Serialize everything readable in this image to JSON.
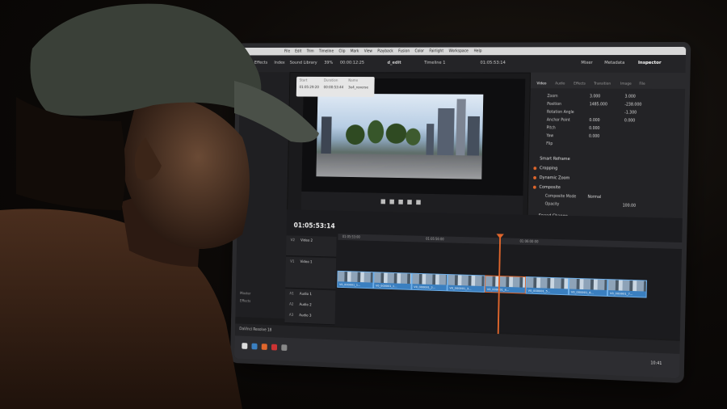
{
  "menu": [
    "File",
    "Edit",
    "Trim",
    "Timeline",
    "Clip",
    "Mark",
    "View",
    "Playback",
    "Fusion",
    "Color",
    "Fairlight",
    "Workspace",
    "Help"
  ],
  "toolbar": {
    "effects": "Effects",
    "index": "Index",
    "sound_library": "Sound Library",
    "zoom": "39%",
    "top_timecode": "00:00:12:25",
    "project_title": "d_edit",
    "timeline_name": "Timeline 1",
    "mixer": "Mixer",
    "metadata": "Metadata",
    "inspector": "Inspector",
    "right_timecode": "01:05:53:14"
  },
  "clip_info": {
    "start_label": "Start",
    "start_value": "01:05:29:20",
    "duration_label": "Duration",
    "duration_value": "00:00:53:44",
    "name_label": "Name",
    "name_value": "3e4_reverse"
  },
  "inspector": {
    "tabs": [
      "Video",
      "Audio",
      "Effects",
      "Transition",
      "Image",
      "File"
    ],
    "rows": [
      {
        "label": "Zoom",
        "x": "3.000",
        "y": "3.000"
      },
      {
        "label": "Position",
        "x": "1485.000",
        "y": "-238.000"
      },
      {
        "label": "Rotation Angle",
        "x": "-1.300",
        "y": ""
      },
      {
        "label": "Anchor Point",
        "x": "0.000",
        "y": "0.000"
      },
      {
        "label": "Pitch",
        "x": "0.000",
        "y": ""
      },
      {
        "label": "Yaw",
        "x": "0.000",
        "y": ""
      },
      {
        "label": "Flip",
        "x": "",
        "y": ""
      }
    ],
    "sections": [
      "Smart Reframe",
      "Cropping",
      "Dynamic Zoom",
      "Composite"
    ],
    "composite_mode_label": "Composite Mode",
    "composite_mode_value": "Normal",
    "opacity_label": "Opacity",
    "opacity_value": "100.00",
    "next_section": "Speed Change"
  },
  "timeline": {
    "timecode": "01:05:53:14",
    "ruler_marks": [
      "01:05:53:00",
      "01:05:56:00",
      "01:06:00:00"
    ],
    "tracks": [
      {
        "id": "V2",
        "name": "Video 2"
      },
      {
        "id": "V1",
        "name": "Video 1"
      },
      {
        "id": "A1",
        "name": "Audio 1"
      },
      {
        "id": "A2",
        "name": "Audio 2"
      },
      {
        "id": "A3",
        "name": "Audio 3"
      }
    ],
    "clips": [
      "V0_000001_1...",
      "V0_000001_1...",
      "V0_000001_2...",
      "V0_000001_3...",
      "V0_000001_4...",
      "V0_000001_5...",
      "V0_000001_6...",
      "V0_000001_7..."
    ]
  },
  "app_name": "DaVinci Resolve 18",
  "left_panel": {
    "label1": "Master",
    "label2": "Effects"
  },
  "taskbar": {
    "time": "10:41"
  },
  "colors": {
    "accent": "#e0662c",
    "clip": "#3a7fc0"
  }
}
